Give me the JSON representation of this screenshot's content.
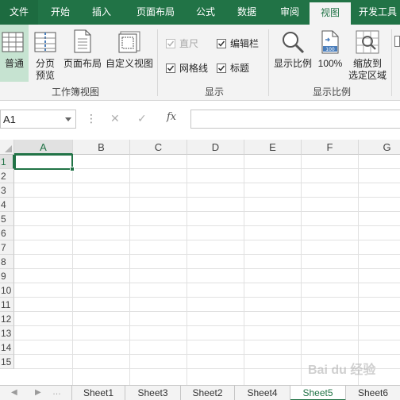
{
  "ribbon_tabs": [
    {
      "label": "文件"
    },
    {
      "label": "开始"
    },
    {
      "label": "插入"
    },
    {
      "label": "页面布局"
    },
    {
      "label": "公式"
    },
    {
      "label": "数据"
    },
    {
      "label": "审阅"
    },
    {
      "label": "视图"
    },
    {
      "label": "开发工具"
    }
  ],
  "active_tab": "视图",
  "ribbon": {
    "workbook_views": {
      "group_label": "工作簿视图",
      "normal": "普通",
      "page_break_line1": "分页",
      "page_break_line2": "预览",
      "page_layout": "页面布局",
      "custom_views": "自定义视图"
    },
    "show": {
      "group_label": "显示",
      "ruler": {
        "label": "直尺",
        "checked": true,
        "enabled": false
      },
      "formula_bar": {
        "label": "编辑栏",
        "checked": true,
        "enabled": true
      },
      "gridlines": {
        "label": "网格线",
        "checked": true,
        "enabled": true
      },
      "headings": {
        "label": "标题",
        "checked": true,
        "enabled": true
      }
    },
    "zoom": {
      "group_label": "显示比例",
      "zoom_button": "显示比例",
      "hundred_percent": "100%",
      "hundred_icon_text": "100",
      "zoom_selection_line1": "缩放到",
      "zoom_selection_line2": "选定区域"
    }
  },
  "formula_bar": {
    "name_box": "A1",
    "fx": "fx",
    "formula": ""
  },
  "grid": {
    "columns": [
      "A",
      "B",
      "C",
      "D",
      "E",
      "F",
      "G"
    ],
    "rows": [
      "1",
      "2",
      "3",
      "4",
      "5",
      "6",
      "7",
      "8",
      "9",
      "10",
      "11",
      "12",
      "13",
      "14",
      "15"
    ],
    "selected_cell": "A1"
  },
  "sheets": [
    {
      "name": "Sheet1"
    },
    {
      "name": "Sheet3"
    },
    {
      "name": "Sheet2"
    },
    {
      "name": "Sheet4"
    },
    {
      "name": "Sheet5"
    },
    {
      "name": "Sheet6"
    }
  ],
  "active_sheet": "Sheet5",
  "watermark": "Bai du 经验",
  "colors": {
    "accent": "#217346",
    "ribbon_bg": "#f3f3f3",
    "selected_button_bg": "#c6e3d1"
  }
}
